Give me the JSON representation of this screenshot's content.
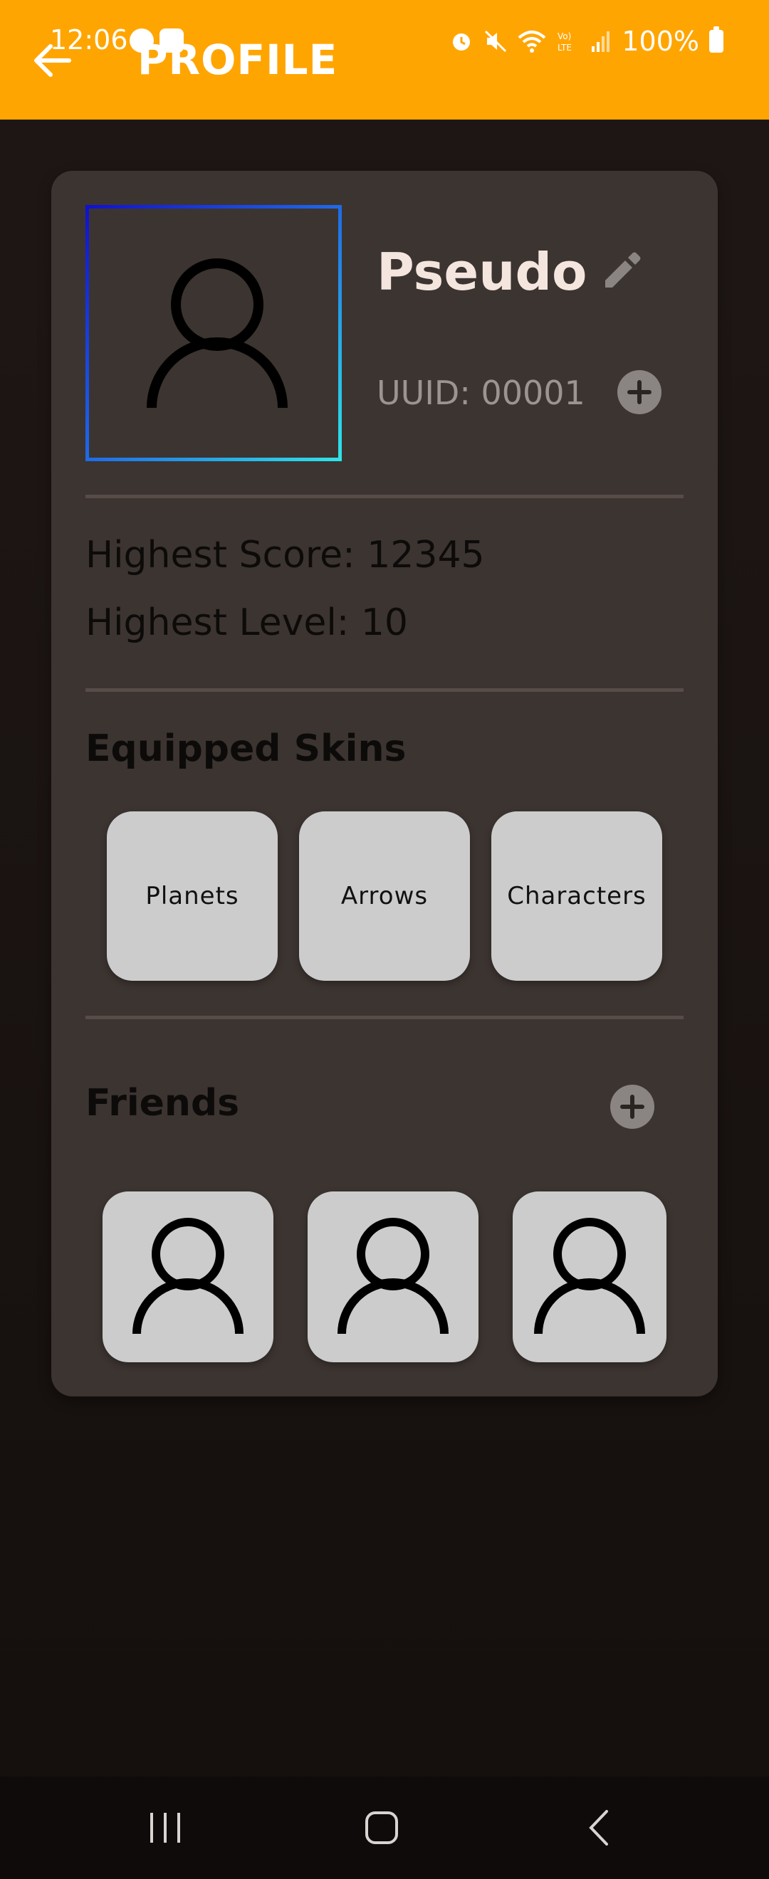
{
  "status_bar": {
    "time": "12:06",
    "battery": "100%"
  },
  "header": {
    "title": "PROFILE",
    "accent_color": "#ffa502"
  },
  "profile": {
    "name": "Pseudo",
    "uuid": "UUID: 00001",
    "highest_score": "Highest Score: 12345",
    "highest_level": "Highest Level: 10"
  },
  "skins": {
    "title": "Equipped Skins",
    "items": [
      {
        "label": "Planets"
      },
      {
        "label": "Arrows"
      },
      {
        "label": "Characters"
      }
    ]
  },
  "friends": {
    "title": "Friends",
    "count_visible": 3
  },
  "icons": {
    "back": "arrow-left-icon",
    "edit": "pencil-icon",
    "add": "plus-icon",
    "avatar": "person-icon"
  }
}
